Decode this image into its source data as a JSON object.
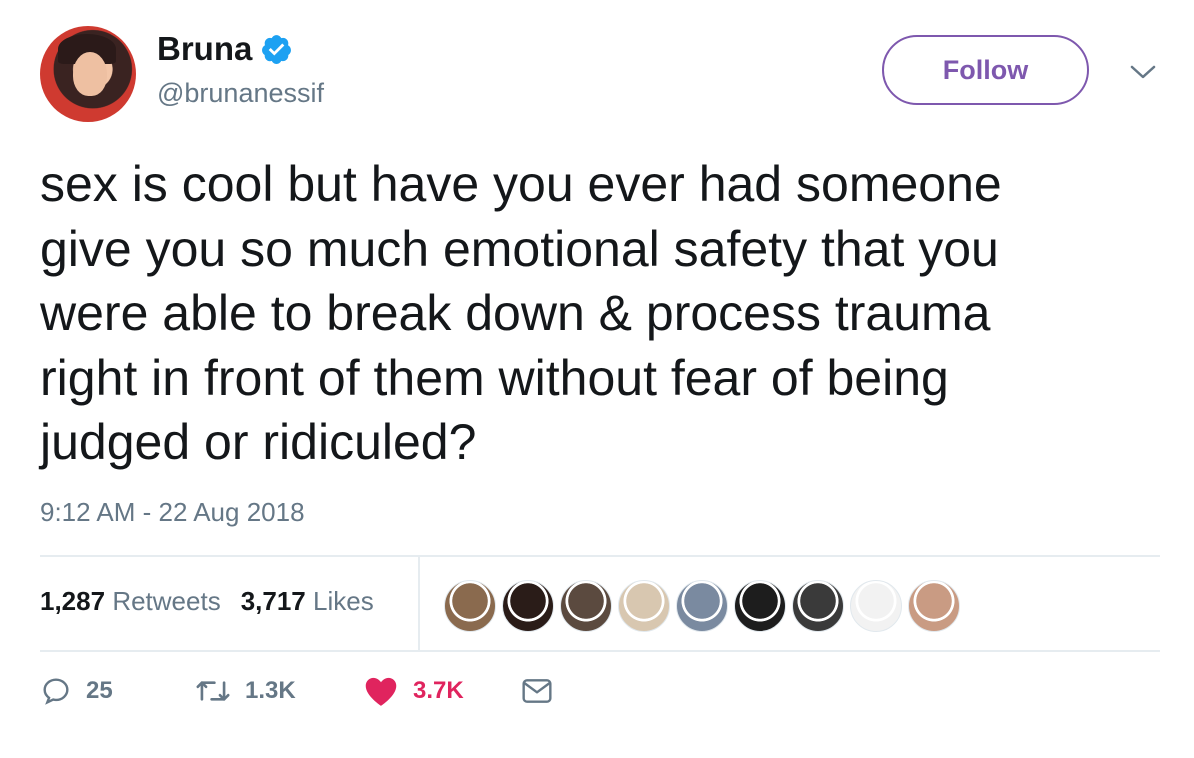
{
  "author": {
    "display_name": "Bruna",
    "handle": "@brunanessif",
    "verified": true
  },
  "follow_button": {
    "label": "Follow"
  },
  "tweet": {
    "text": "sex is cool but have you ever had someone\ngive you so much emotional safety that you\nwere able to break down & process trauma\nright in front of them without fear of being\njudged or ridiculed?",
    "timestamp": "9:12 AM - 22 Aug 2018"
  },
  "stats": {
    "retweets_count": "1,287",
    "retweets_label": "Retweets",
    "likes_count": "3,717",
    "likes_label": "Likes"
  },
  "liker_avatars": [
    {
      "color": "#8a6a4e"
    },
    {
      "color": "#2a1c18"
    },
    {
      "color": "#5b4a3f"
    },
    {
      "color": "#d8c7b0"
    },
    {
      "color": "#7a8aa0"
    },
    {
      "color": "#1d1d1d"
    },
    {
      "color": "#3a3a3a"
    },
    {
      "color": "#f2f2f2"
    },
    {
      "color": "#c99b83"
    }
  ],
  "actions": {
    "reply_count": "25",
    "retweet_count": "1.3K",
    "like_count": "3.7K"
  },
  "colors": {
    "accent": "#7e58ae",
    "verified": "#1da1f2",
    "like": "#e0245e",
    "muted": "#657786"
  }
}
